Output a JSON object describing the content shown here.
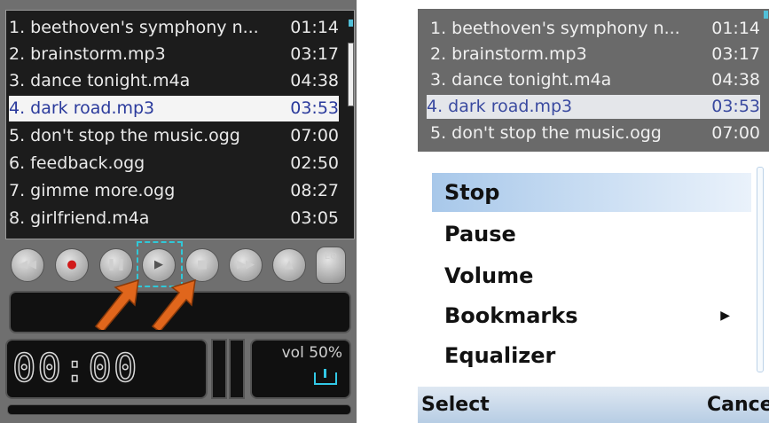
{
  "left_player": {
    "playlist": [
      {
        "title": "1. beethoven's symphony n...",
        "duration": "01:14"
      },
      {
        "title": "2. brainstorm.mp3",
        "duration": "03:17"
      },
      {
        "title": "3. dance tonight.m4a",
        "duration": "04:38"
      },
      {
        "title": "4. dark road.mp3",
        "duration": "03:53",
        "selected": true
      },
      {
        "title": "5. don't stop the music.ogg",
        "duration": "07:00"
      },
      {
        "title": "6. feedback.ogg",
        "duration": "02:50"
      },
      {
        "title": "7. gimme more.ogg",
        "duration": "08:27"
      },
      {
        "title": "8. girlfriend.m4a",
        "duration": "03:05"
      }
    ],
    "controls": [
      {
        "name": "rewind-icon",
        "glyph": "◀◀"
      },
      {
        "name": "record-icon",
        "glyph": "●"
      },
      {
        "name": "pause-icon",
        "glyph": "❚❚"
      },
      {
        "name": "play-icon",
        "glyph": "▶"
      },
      {
        "name": "stop-icon",
        "glyph": "■"
      },
      {
        "name": "fast-forward-icon",
        "glyph": "▶▶"
      },
      {
        "name": "eject-icon",
        "glyph": "▲"
      },
      {
        "name": "equalizer-icon",
        "glyph": "EQ"
      }
    ],
    "time_display": "00:00",
    "volume_label": "vol 50%",
    "accent_color": "#30c8d8",
    "arrow_color": "#e0661c"
  },
  "right_player": {
    "playlist": [
      {
        "title": "1. beethoven's symphony n...",
        "duration": "01:14"
      },
      {
        "title": "2. brainstorm.mp3",
        "duration": "03:17"
      },
      {
        "title": "3. dance tonight.m4a",
        "duration": "04:38"
      },
      {
        "title": "4. dark road.mp3",
        "duration": "03:53",
        "selected": true
      },
      {
        "title": "5. don't stop the music.ogg",
        "duration": "07:00"
      }
    ],
    "menu": {
      "items": [
        {
          "label": "Stop",
          "selected": true
        },
        {
          "label": "Pause"
        },
        {
          "label": "Volume"
        },
        {
          "label": "Bookmarks",
          "has_submenu": true
        },
        {
          "label": "Equalizer"
        }
      ]
    },
    "softkeys": {
      "left": "Select",
      "right": "Cancel"
    }
  }
}
